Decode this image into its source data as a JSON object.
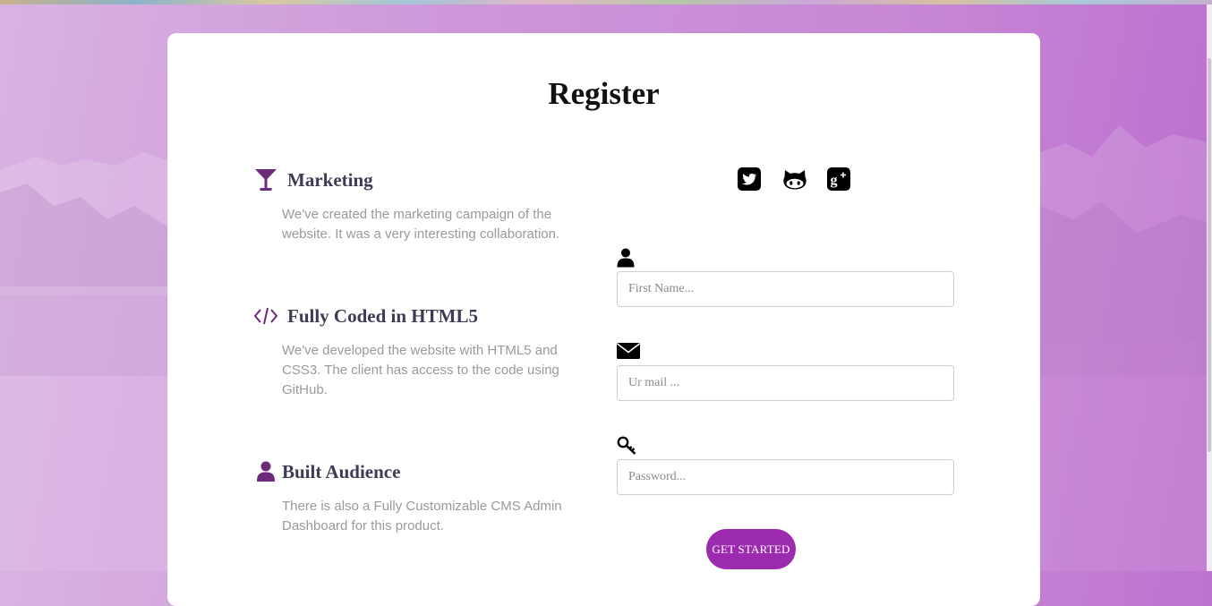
{
  "page": {
    "title": "Register"
  },
  "features": [
    {
      "icon": "cocktail-icon",
      "title": "Marketing",
      "description": "We've created the marketing campaign of the website. It was a very interesting collaboration."
    },
    {
      "icon": "code-icon",
      "title": "Fully Coded in HTML5",
      "description": "We've developed the website with HTML5 and CSS3. The client has access to the code using GitHub."
    },
    {
      "icon": "user-icon",
      "title": "Built Audience",
      "description": "There is also a Fully Customizable CMS Admin Dashboard for this product."
    }
  ],
  "social": [
    {
      "icon": "twitter-icon"
    },
    {
      "icon": "github-icon"
    },
    {
      "icon": "google-plus-icon"
    }
  ],
  "form": {
    "first_name": {
      "icon": "user-icon",
      "placeholder": "First Name...",
      "value": ""
    },
    "email": {
      "icon": "envelope-icon",
      "placeholder": "Ur mail ...",
      "value": ""
    },
    "password": {
      "icon": "key-icon",
      "placeholder": "Password...",
      "value": ""
    },
    "submit_label": "GET STARTED"
  },
  "colors": {
    "accent": "#9d2bb0",
    "feature_icon": "#6b2a7a",
    "heading": "#3d3c55",
    "body_text": "#9a9a9a"
  }
}
